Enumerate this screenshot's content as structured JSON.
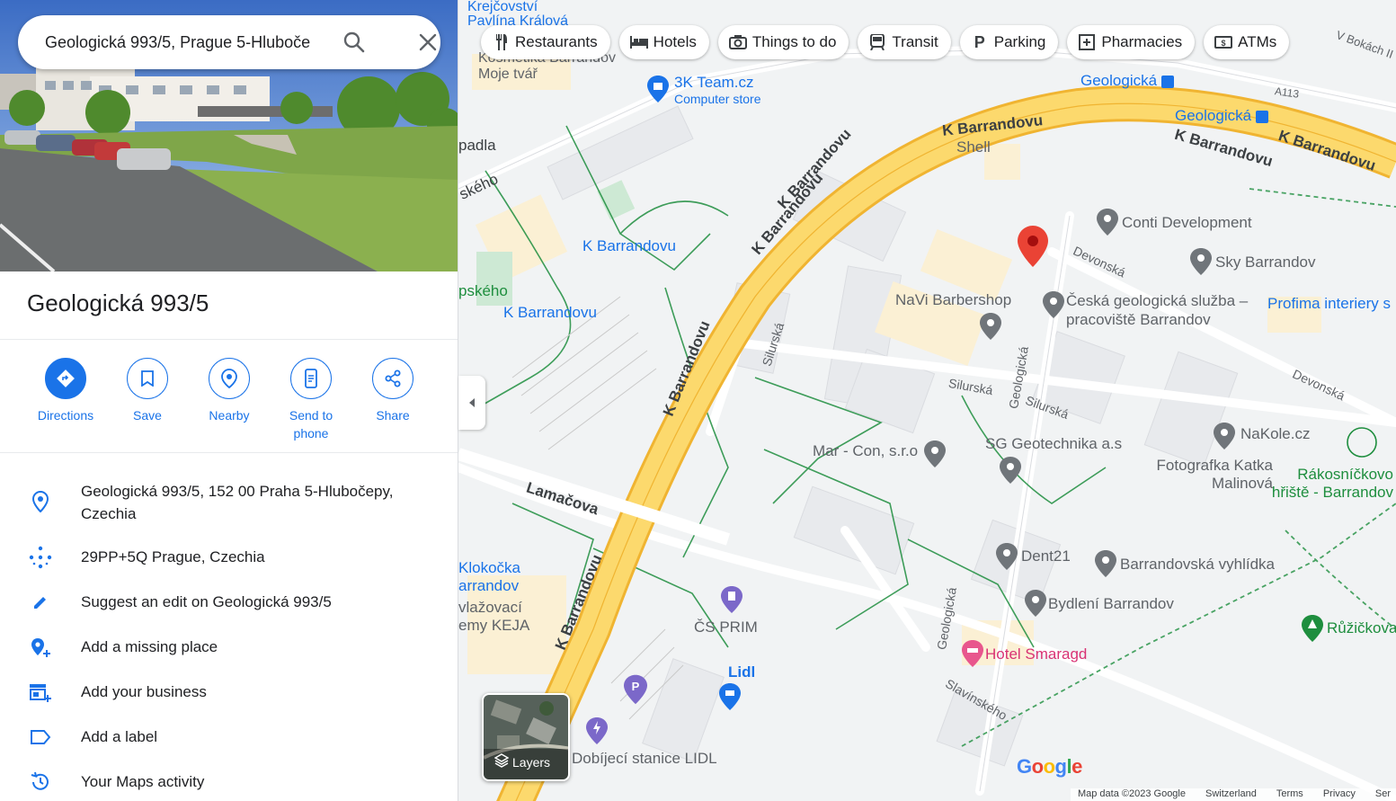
{
  "search": {
    "value": "Geologická 993/5, Prague 5-Hluboče"
  },
  "place": {
    "title": "Geologická 993/5"
  },
  "actions": [
    {
      "label": "Directions"
    },
    {
      "label": "Save"
    },
    {
      "label": "Nearby"
    },
    {
      "label": "Send to phone"
    },
    {
      "label": "Share"
    }
  ],
  "info": {
    "address": "Geologická 993/5, 152 00 Praha 5-Hlubočepy, Czechia",
    "plus_code": "29PP+5Q Prague, Czechia",
    "suggest_edit": "Suggest an edit on Geologická 993/5",
    "add_place": "Add a missing place",
    "add_business": "Add your business",
    "add_label": "Add a label",
    "activity": "Your Maps activity"
  },
  "chips": [
    {
      "label": "Restaurants",
      "icon": "fork-knife-icon"
    },
    {
      "label": "Hotels",
      "icon": "bed-icon"
    },
    {
      "label": "Things to do",
      "icon": "camera-icon"
    },
    {
      "label": "Transit",
      "icon": "train-icon"
    },
    {
      "label": "Parking",
      "icon": "parking-icon"
    },
    {
      "label": "Pharmacies",
      "icon": "pharmacy-icon"
    },
    {
      "label": "ATMs",
      "icon": "atm-icon"
    }
  ],
  "map_labels": {
    "road_kbarrandovu": "K Barrandovu",
    "devonska": "Devonská",
    "silurska": "Silurská",
    "geologicka": "Geologická",
    "lamacova": "Lamačova",
    "slavinskeho": "Slavínského",
    "v_bokach": "V Bokách II",
    "a113": "A113",
    "skeho": "ského",
    "pskeho": "pského",
    "padla": "padla"
  },
  "pois": {
    "krejcovstvi": "Krejčovství Pavlína Králová",
    "kosmetika": "Kosmetika Barrandov Moje tvář",
    "k3team": "3K Team.cz",
    "k3team_sub": "Computer store",
    "geologicka1": "Geologická",
    "geologicka2": "Geologická",
    "shell": "Shell",
    "conti": "Conti Development",
    "sky": "Sky Barrandov",
    "kbarr_stop1": "K Barrandovu",
    "kbarr_stop2": "K Barrandovu",
    "navi": "NaVi Barbershop",
    "cgs": "Česká geologická služba – pracoviště Barrandov",
    "profima": "Profima interiery s",
    "marcon": "Mar - Con, s.r.o",
    "sggeo": "SG Geotechnika a.s",
    "nakole": "NaKole.cz",
    "fotografka": "Fotografka Katka Malinová",
    "rakosnickovo": "Rákosníčkovo hřiště - Barrandov",
    "dent21": "Dent21",
    "vyhlidka": "Barrandovská vyhlídka",
    "bydleni": "Bydlení Barrandov",
    "klokocka": "Klokočka arrandov",
    "vlazovaci": "vlažovací emy KEJA",
    "csprim": "ČS PRIM",
    "lidl": "Lidl",
    "hotel": "Hotel Smaragd",
    "ruzickova": "Růžičkova",
    "nabijeci": "Dobíjecí stanice LIDL"
  },
  "layers_label": "Layers",
  "google_logo": "Google",
  "footer": {
    "mapdata": "Map data ©2023 Google",
    "region": "Switzerland",
    "terms": "Terms",
    "privacy": "Privacy",
    "send": "Ser"
  },
  "colors": {
    "accent": "#1a73e8",
    "major_road": "#fcd96d",
    "major_road_edge": "#f0b431",
    "pin": "#ea4335",
    "park_line": "#1e8e3e"
  }
}
